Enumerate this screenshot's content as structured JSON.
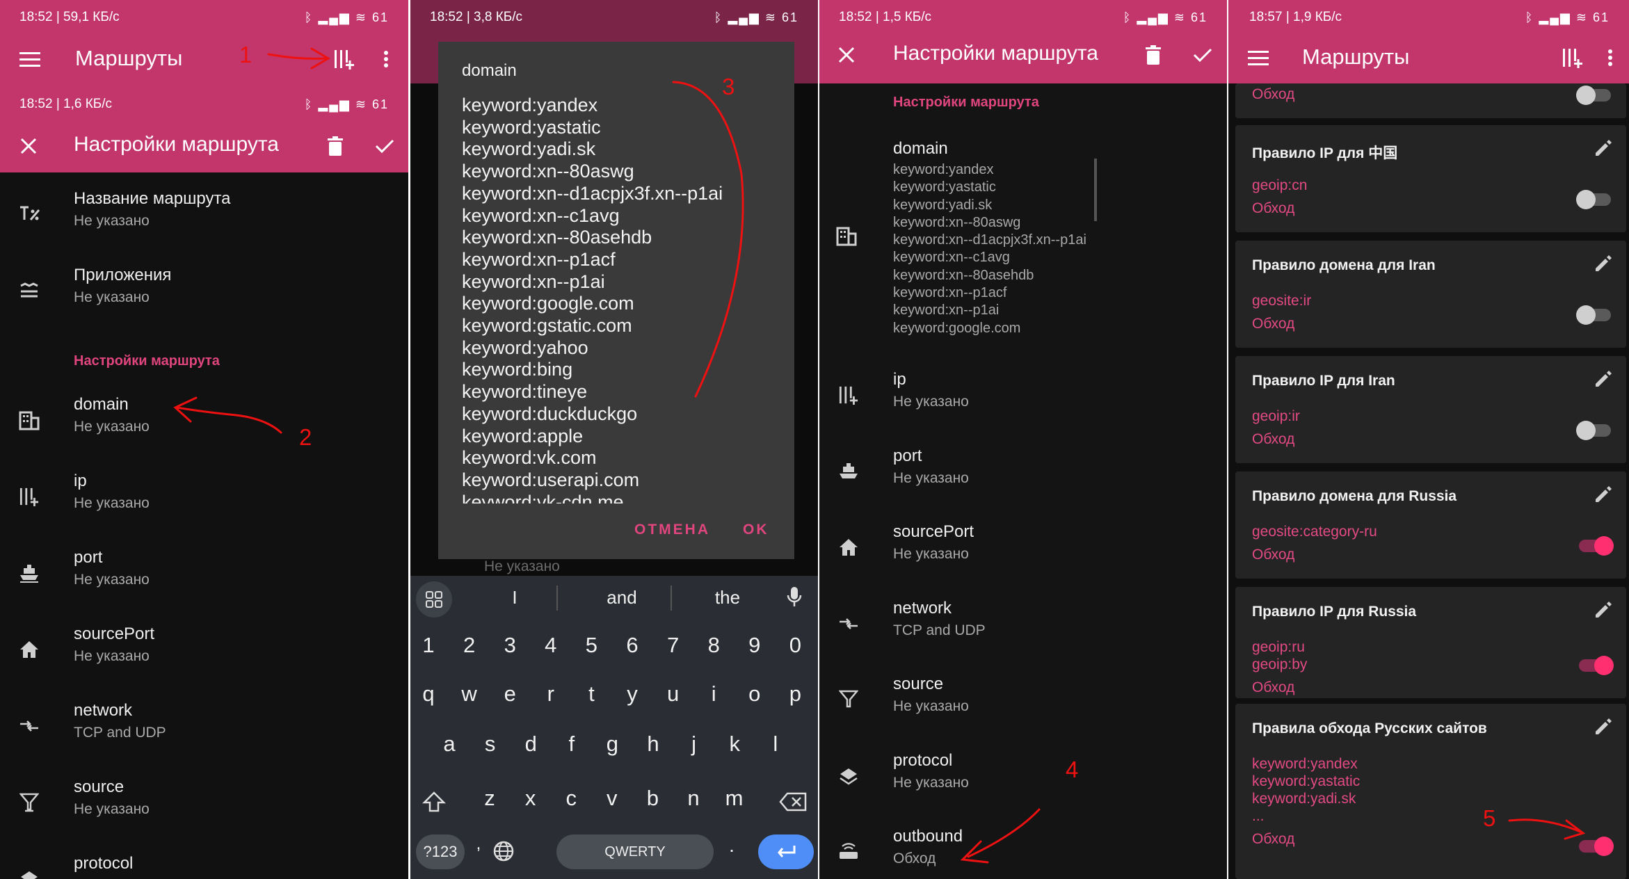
{
  "p1": {
    "sb1_left": "18:52 | 59,1 КБ/с",
    "sb1_right": "ᛒ ▂▄▆ ≋ 61",
    "title_list": "Маршруты",
    "sb2_left": "18:52 | 1,6 КБ/с",
    "sb2_right": "ᛒ ▂▄▆ ≋ 61",
    "title_edit": "Настройки маршрута",
    "rows": [
      {
        "t": "Название маршрута",
        "s": "Не указано"
      },
      {
        "t": "Приложения",
        "s": "Не указано"
      }
    ],
    "section": "Настройки маршрута",
    "rows2": [
      {
        "t": "domain",
        "s": "Не указано"
      },
      {
        "t": "ip",
        "s": "Не указано"
      },
      {
        "t": "port",
        "s": "Не указано"
      },
      {
        "t": "sourcePort",
        "s": "Не указано"
      },
      {
        "t": "network",
        "s": "TCP and UDP"
      },
      {
        "t": "source",
        "s": "Не указано"
      },
      {
        "t": "protocol",
        "s": ""
      }
    ]
  },
  "p2": {
    "sb_left": "18:52 | 3,8 КБ/с",
    "sb_right": "ᛒ ▂▄▆ ≋ 61",
    "dialog_title": "domain",
    "lines": [
      "keyword:yandex",
      "keyword:yastatic",
      "keyword:yadi.sk",
      "keyword:xn--80aswg",
      "keyword:xn--d1acpjx3f.xn--p1ai",
      "keyword:xn--c1avg",
      "keyword:xn--80asehdb",
      "keyword:xn--p1acf",
      "keyword:xn--p1ai",
      "keyword:google.com",
      "keyword:gstatic.com",
      "keyword:yahoo",
      "keyword:bing",
      "keyword:tineye",
      "keyword:duckduckgo",
      "keyword:apple",
      "keyword:vk.com",
      "keyword:userapi.com",
      "keyword:vk-cdn.me"
    ],
    "cancel": "ОТМЕНА",
    "ok": "OK",
    "behind_text": "Не указано",
    "suggestions": [
      "I",
      "and",
      "the"
    ],
    "row_num": [
      "1",
      "2",
      "3",
      "4",
      "5",
      "6",
      "7",
      "8",
      "9",
      "0"
    ],
    "row_q": [
      "q",
      "w",
      "e",
      "r",
      "t",
      "y",
      "u",
      "i",
      "o",
      "p"
    ],
    "row_a": [
      "a",
      "s",
      "d",
      "f",
      "g",
      "h",
      "j",
      "k",
      "l"
    ],
    "row_z": [
      "z",
      "x",
      "c",
      "v",
      "b",
      "n",
      "m"
    ],
    "sym": "?123",
    "space": "QWERTY",
    "dot": ".",
    "comma": ","
  },
  "p3": {
    "sb_left": "18:52 | 1,5 КБ/с",
    "sb_right": "ᛒ ▂▄▆ ≋ 61",
    "title": "Настройки маршрута",
    "section": "Настройки маршрута",
    "domain_title": "domain",
    "domain_lines": [
      "keyword:yandex",
      "keyword:yastatic",
      "keyword:yadi.sk",
      "keyword:xn--80aswg",
      "keyword:xn--d1acpjx3f.xn--p1ai",
      "keyword:xn--c1avg",
      "keyword:xn--80asehdb",
      "keyword:xn--p1acf",
      "keyword:xn--p1ai",
      "keyword:google.com"
    ],
    "rows": [
      {
        "t": "ip",
        "s": "Не указано"
      },
      {
        "t": "port",
        "s": "Не указано"
      },
      {
        "t": "sourcePort",
        "s": "Не указано"
      },
      {
        "t": "network",
        "s": "TCP and UDP"
      },
      {
        "t": "source",
        "s": "Не указано"
      },
      {
        "t": "protocol",
        "s": "Не указано"
      },
      {
        "t": "outbound",
        "s": "Обход"
      }
    ]
  },
  "p4": {
    "sb_left": "18:57 | 1,9 КБ/с",
    "sb_right": "ᛒ ▂▄▆ ≋ 61",
    "title": "Маршруты",
    "top_partial": "Обход",
    "cards": [
      {
        "title": "Правило IP для 中国",
        "vals": [
          "geoip:cn"
        ],
        "out": "Обход",
        "on": false
      },
      {
        "title": "Правило домена для Iran",
        "vals": [
          "geosite:ir"
        ],
        "out": "Обход",
        "on": false
      },
      {
        "title": "Правило IP для Iran",
        "vals": [
          "geoip:ir"
        ],
        "out": "Обход",
        "on": false
      },
      {
        "title": "Правило домена для Russia",
        "vals": [
          "geosite:category-ru"
        ],
        "out": "Обход",
        "on": true
      },
      {
        "title": "Правило IP для Russia",
        "vals": [
          "geoip:ru",
          "geoip:by"
        ],
        "out": "Обход",
        "on": true
      },
      {
        "title": "Правила обхода Русских сайтов",
        "vals": [
          "keyword:yandex",
          "keyword:yastatic",
          "keyword:yadi.sk",
          "..."
        ],
        "out": "Обход",
        "on": true
      }
    ]
  },
  "annotations": {
    "a1": "1",
    "a2": "2",
    "a3": "3",
    "a4": "4",
    "a5": "5"
  },
  "colors": {
    "accent": "#c2366c",
    "pink_text": "#e34a84",
    "toggle_on": "#ff2f70",
    "annotation": "#e11111"
  }
}
